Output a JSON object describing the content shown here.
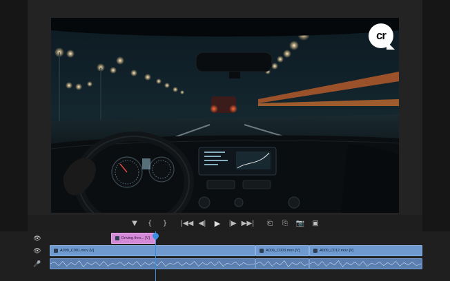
{
  "watermark": {
    "text": "cr"
  },
  "transport": {
    "buttons": [
      {
        "name": "add-marker-button",
        "glyph": "▼"
      },
      {
        "name": "mark-in-button",
        "glyph": "{"
      },
      {
        "name": "mark-out-button",
        "glyph": "}"
      },
      {
        "name": "go-to-in-button",
        "glyph": "|◀◀"
      },
      {
        "name": "step-back-button",
        "glyph": "◀|"
      },
      {
        "name": "play-button",
        "glyph": "▶"
      },
      {
        "name": "step-forward-button",
        "glyph": "|▶"
      },
      {
        "name": "go-to-out-button",
        "glyph": "▶▶|"
      },
      {
        "name": "insert-button",
        "glyph": "⎗"
      },
      {
        "name": "overwrite-button",
        "glyph": "⎘"
      },
      {
        "name": "export-frame-button",
        "glyph": "📷"
      },
      {
        "name": "comparison-view-button",
        "glyph": "▣"
      }
    ]
  },
  "timeline": {
    "title_clip": {
      "label": "Driving thro... [V]"
    },
    "video_clips": [
      {
        "label": "A009_C001.mov [V]"
      },
      {
        "label": "A009_C003.mov [V]"
      },
      {
        "label": "A009_C012.mov [V]"
      }
    ],
    "track_icons": {
      "v2": "👁",
      "v1": "👁",
      "a1": "🎤"
    }
  },
  "colors": {
    "video_clip": "#6f9ad0",
    "title_clip": "#d48ad6",
    "playhead": "#3b8fe0"
  }
}
